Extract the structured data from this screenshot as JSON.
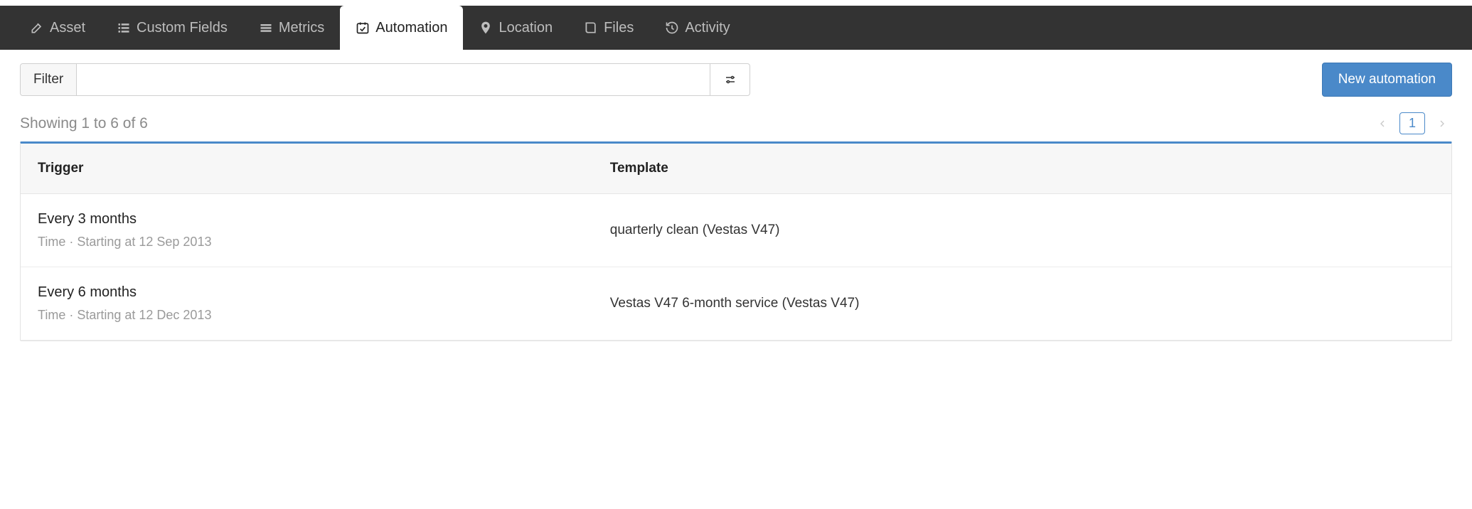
{
  "tabs": [
    {
      "id": "asset",
      "label": "Asset",
      "active": false
    },
    {
      "id": "custom-fields",
      "label": "Custom Fields",
      "active": false
    },
    {
      "id": "metrics",
      "label": "Metrics",
      "active": false
    },
    {
      "id": "automation",
      "label": "Automation",
      "active": true
    },
    {
      "id": "location",
      "label": "Location",
      "active": false
    },
    {
      "id": "files",
      "label": "Files",
      "active": false
    },
    {
      "id": "activity",
      "label": "Activity",
      "active": false
    }
  ],
  "filter": {
    "label": "Filter",
    "value": ""
  },
  "buttons": {
    "new_automation": "New automation"
  },
  "listing": {
    "summary": "Showing 1 to 6 of 6",
    "page": "1"
  },
  "table": {
    "headers": {
      "trigger": "Trigger",
      "template": "Template"
    },
    "rows": [
      {
        "trigger_title": "Every 3 months",
        "trigger_sub": "Time  ·  Starting at 12 Sep 2013",
        "template": "quarterly clean (Vestas V47)"
      },
      {
        "trigger_title": "Every 6 months",
        "trigger_sub": "Time  ·  Starting at 12 Dec 2013",
        "template": "Vestas V47 6-month service (Vestas V47)"
      }
    ]
  }
}
